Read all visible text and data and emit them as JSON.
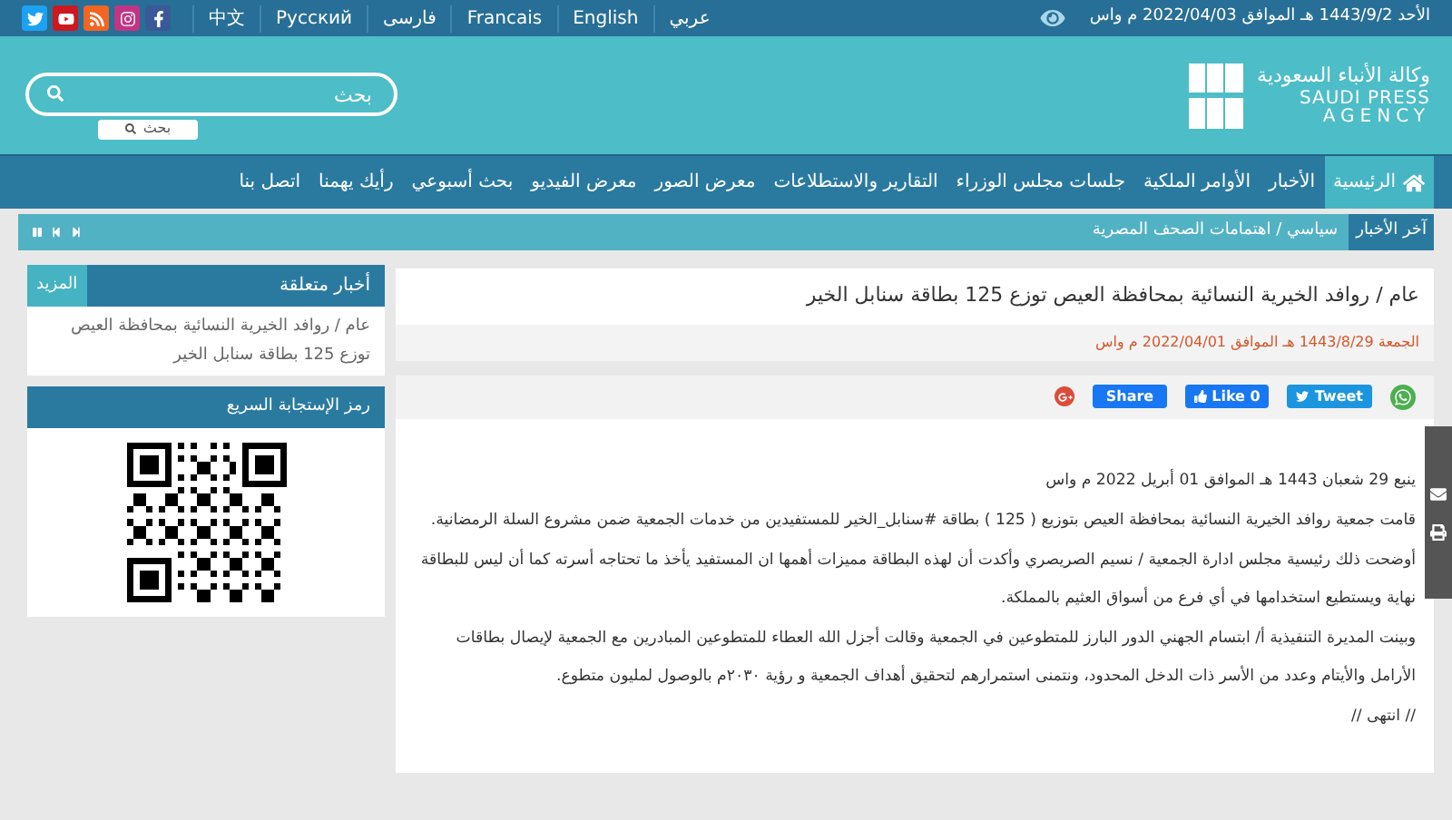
{
  "top_bar": {
    "date": "الأحد 1443/9/2 هـ الموافق 2022/04/03 م واس",
    "languages": [
      "عربي",
      "English",
      "Francais",
      "فارسی",
      "Русский",
      "中文"
    ],
    "social": [
      {
        "kind": "facebook"
      },
      {
        "kind": "instagram"
      },
      {
        "kind": "rss"
      },
      {
        "kind": "youtube"
      },
      {
        "kind": "twitter"
      }
    ]
  },
  "header": {
    "logo": {
      "arabic": "وكالة الأنباء السعودية",
      "english_line_1": "SAUDI PRESS",
      "english_line_2": "AGENCY"
    },
    "search": {
      "placeholder": "بحث",
      "button": "بحث"
    }
  },
  "nav": [
    {
      "label": "الرئيسية",
      "selected": true
    },
    {
      "label": "الأخبار",
      "selected": false
    },
    {
      "label": "الأوامر الملكية",
      "selected": false
    },
    {
      "label": "جلسات مجلس الوزراء",
      "selected": false
    },
    {
      "label": "التقارير والاستطلاعات",
      "selected": false
    },
    {
      "label": "معرض الصور",
      "selected": false
    },
    {
      "label": "معرض الفيديو",
      "selected": false
    },
    {
      "label": "بحث أسبوعي",
      "selected": false
    },
    {
      "label": "رأيك يهمنا",
      "selected": false
    },
    {
      "label": "اتصل بنا",
      "selected": false
    }
  ],
  "ticker": {
    "label": "آخر الأخبار",
    "headline": "سياسي / اهتمامات الصحف المصرية"
  },
  "article": {
    "title": "عام / روافد الخيرية النسائية بمحافظة العيص توزع 125 بطاقة سنابل الخير",
    "date": "الجمعة 1443/8/29 هـ الموافق 2022/04/01 م واس",
    "share": [
      {
        "kind": "whatsapp"
      },
      {
        "kind": "tweet",
        "label": "Tweet"
      },
      {
        "kind": "like",
        "label": "Like 0"
      },
      {
        "kind": "share",
        "label": "Share"
      },
      {
        "kind": "gplus"
      }
    ],
    "paragraphs": [
      "ينبع 29 شعبان 1443 هـ الموافق 01 أبريل 2022 م واس",
      "قامت جمعية روافد الخيرية النسائية بمحافظة العيص بتوزيع ( 125 ) بطاقة #سنابل_الخير للمستفيدين من خدمات الجمعية ضمن مشروع السلة الرمضانية.",
      "أوضحت ذلك رئيسية مجلس ادارة الجمعية / نسيم الصريصري وأكدت أن لهذه البطاقة مميزات أهمها ان المستفيد يأخذ ما تحتاجه أسرته كما أن ليس للبطاقة نهاية ويستطيع استخدامها في أي فرع من أسواق العثيم بالمملكة.",
      "وبينت المديرة التنفيذية أ/ ابتسام الجهني الدور البارز للمتطوعين في الجمعية وقالت أجزل الله العطاء للمتطوعين المبادرين مع الجمعية لإيصال بطاقات الأرامل والأيتام وعدد من الأسر ذات الدخل المحدود، ونتمنى استمرارهم لتحقيق أهداف الجمعية و رؤية ٢٠٣٠م بالوصول لمليون متطوع.",
      "// انتهى //"
    ]
  },
  "sidebar": {
    "related": {
      "title": "أخبار متعلقة",
      "more": "المزيد",
      "items": [
        "عام / روافد الخيرية النسائية بمحافظة العيص توزع 125 بطاقة سنابل الخير"
      ]
    },
    "qr": {
      "title": "رمز الإستجابة السريع"
    }
  }
}
